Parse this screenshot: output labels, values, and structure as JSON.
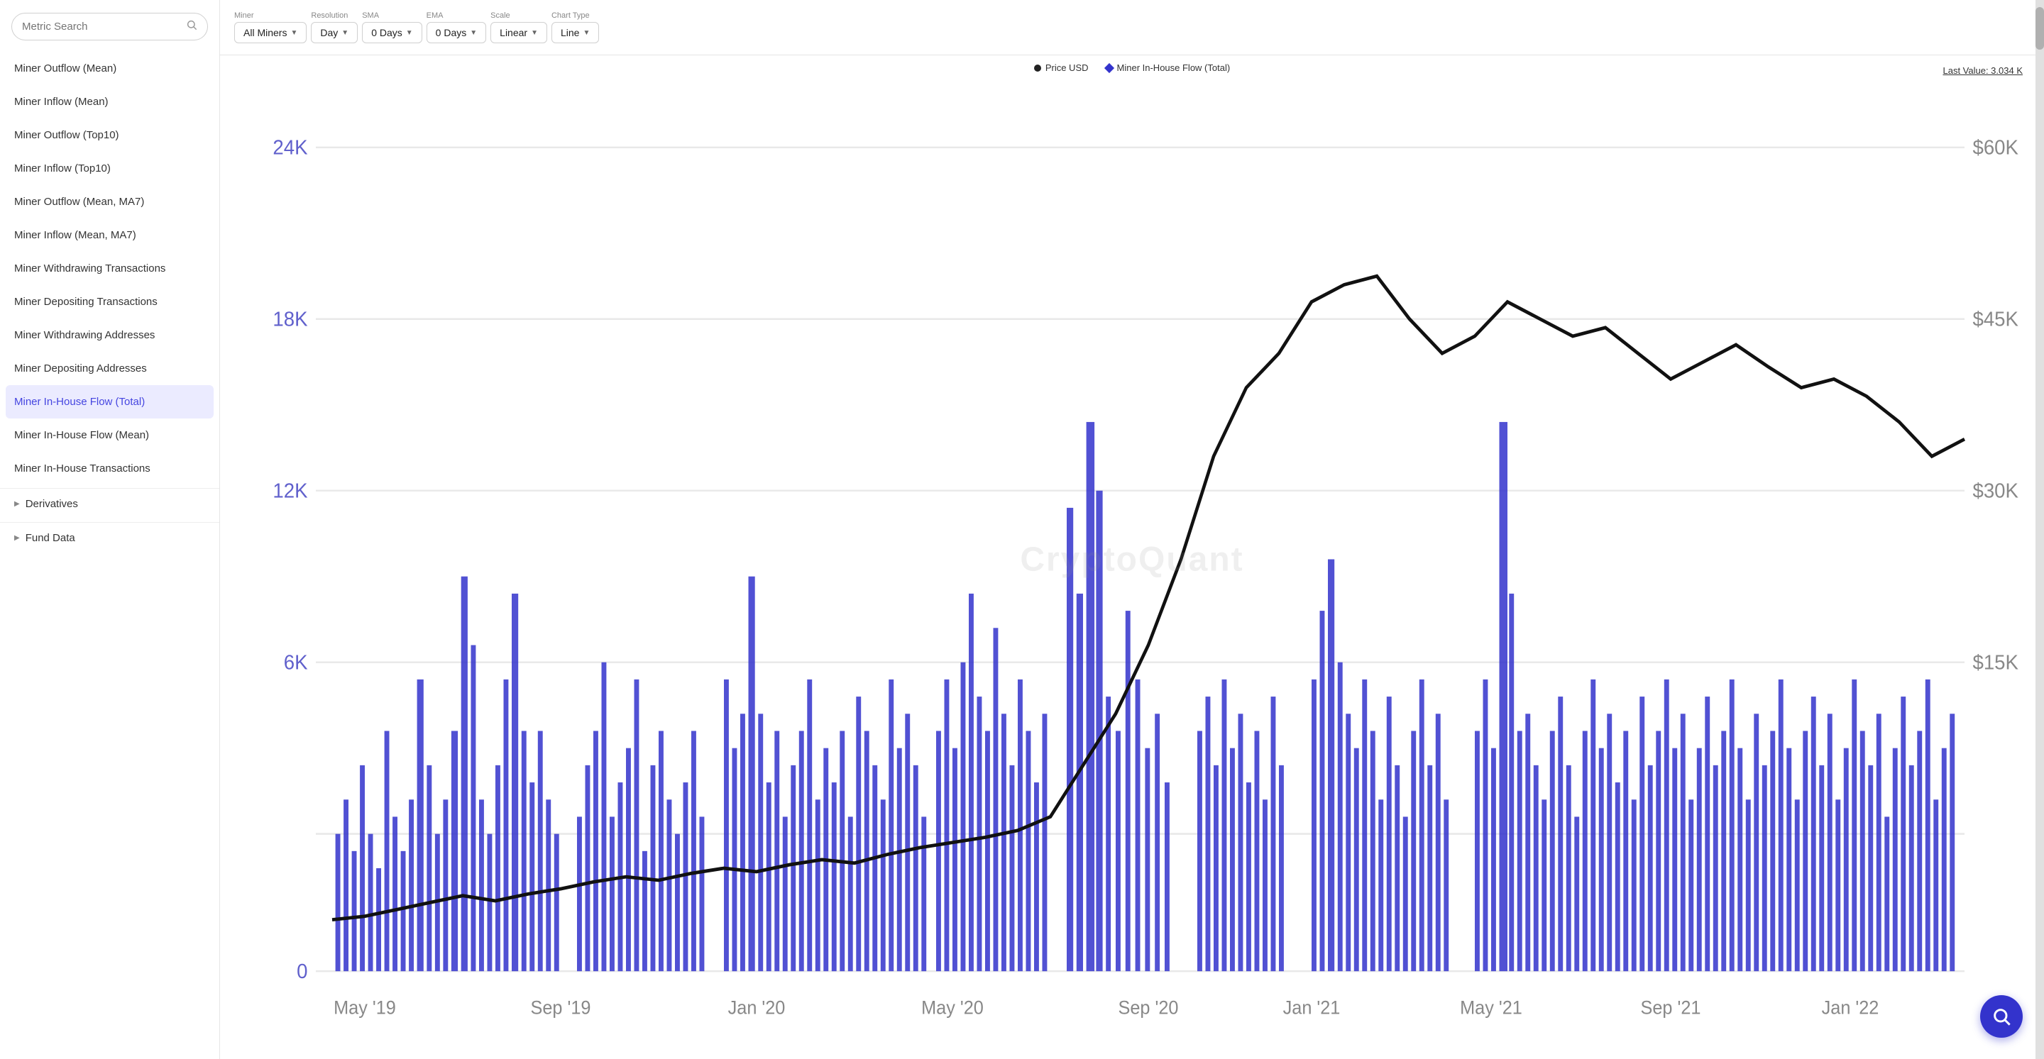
{
  "sidebar": {
    "search_placeholder": "Metric Search",
    "items": [
      {
        "id": "miner-outflow-mean",
        "label": "Miner Outflow (Mean)",
        "active": false
      },
      {
        "id": "miner-inflow-mean",
        "label": "Miner Inflow (Mean)",
        "active": false
      },
      {
        "id": "miner-outflow-top10",
        "label": "Miner Outflow (Top10)",
        "active": false
      },
      {
        "id": "miner-inflow-top10",
        "label": "Miner Inflow (Top10)",
        "active": false
      },
      {
        "id": "miner-outflow-mean-ma7",
        "label": "Miner Outflow (Mean, MA7)",
        "active": false
      },
      {
        "id": "miner-inflow-mean-ma7",
        "label": "Miner Inflow (Mean, MA7)",
        "active": false
      },
      {
        "id": "miner-withdrawing-transactions",
        "label": "Miner Withdrawing Transactions",
        "active": false
      },
      {
        "id": "miner-depositing-transactions",
        "label": "Miner Depositing Transactions",
        "active": false
      },
      {
        "id": "miner-withdrawing-addresses",
        "label": "Miner Withdrawing Addresses",
        "active": false
      },
      {
        "id": "miner-depositing-addresses",
        "label": "Miner Depositing Addresses",
        "active": false
      },
      {
        "id": "miner-in-house-flow-total",
        "label": "Miner In-House Flow (Total)",
        "active": true
      },
      {
        "id": "miner-in-house-flow-mean",
        "label": "Miner In-House Flow (Mean)",
        "active": false
      },
      {
        "id": "miner-in-house-transactions",
        "label": "Miner In-House Transactions",
        "active": false
      }
    ],
    "sections": [
      {
        "id": "derivatives",
        "label": "Derivatives"
      },
      {
        "id": "fund-data",
        "label": "Fund Data"
      }
    ]
  },
  "toolbar": {
    "miner_label": "Miner",
    "miner_value": "All Miners",
    "resolution_label": "Resolution",
    "resolution_value": "Day",
    "sma_label": "SMA",
    "sma_value": "0 Days",
    "ema_label": "EMA",
    "ema_value": "0 Days",
    "scale_label": "Scale",
    "scale_value": "Linear",
    "chart_type_label": "Chart Type",
    "chart_type_value": "Line"
  },
  "chart": {
    "legend": {
      "price_label": "Price USD",
      "flow_label": "Miner In-House Flow (Total)"
    },
    "last_value_label": "Last Value: 3.034 K",
    "watermark": "CryptoQuant",
    "y_axis_left": [
      "24K",
      "18K",
      "12K",
      "6K",
      "0"
    ],
    "y_axis_right": [
      "$60K",
      "$45K",
      "$30K",
      "$15K"
    ],
    "x_axis": [
      "May '19",
      "Sep '19",
      "Jan '20",
      "May '20",
      "Sep '20",
      "Jan '21",
      "May '21",
      "Sep '21",
      "Jan '22"
    ]
  },
  "fab": {
    "label": "search"
  }
}
